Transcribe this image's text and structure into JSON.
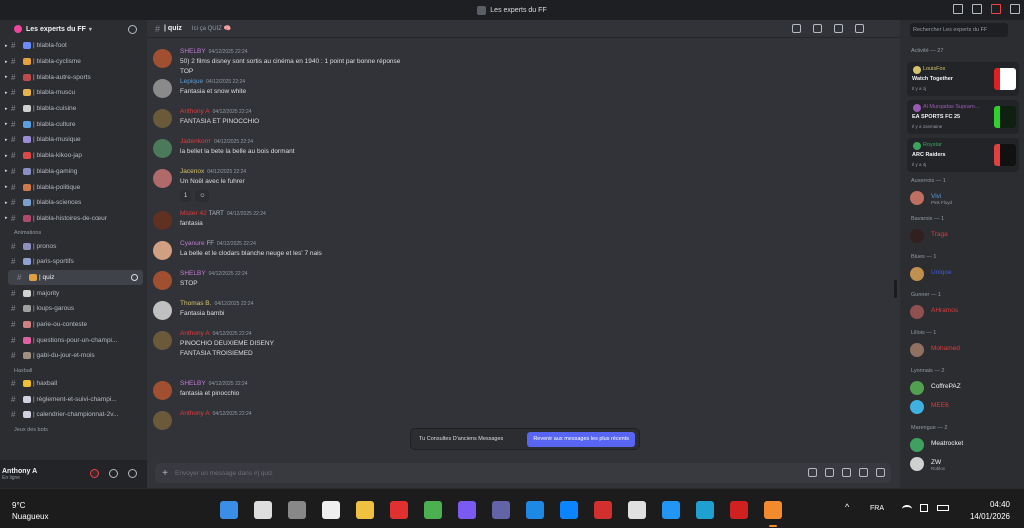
{
  "window": {
    "title": "Les experts du FF"
  },
  "server": {
    "name": "Les experts du FF"
  },
  "channels": [
    {
      "label": "| blabla-foot",
      "emoji_color": "#6b8cff"
    },
    {
      "label": "| blabla-cyclisme",
      "emoji_color": "#e6a23c"
    },
    {
      "label": "| blabla-autre-sports",
      "emoji_color": "#c04a4a"
    },
    {
      "label": "| blabla-muscu",
      "emoji_color": "#e8b34a"
    },
    {
      "label": "| blabla-cuisine",
      "emoji_color": "#cfcfcf"
    },
    {
      "label": "| blabla-culture",
      "emoji_color": "#5aa0e0"
    },
    {
      "label": "| blabla-musique",
      "emoji_color": "#9b8cd6"
    },
    {
      "label": "| blabla-kikoo-jap",
      "emoji_color": "#e04848"
    },
    {
      "label": "| blabla-gaming",
      "emoji_color": "#8a8ec6"
    },
    {
      "label": "| blabla-politique",
      "emoji_color": "#d07a4a"
    },
    {
      "label": "| blabla-sciences",
      "emoji_color": "#7aa0d0"
    },
    {
      "label": "| blabla-histoires-de-cœur",
      "emoji_color": "#b04a6a"
    }
  ],
  "animations": {
    "category": "Animations",
    "items": [
      {
        "label": "| pronos",
        "emoji_color": "#9090c0"
      },
      {
        "label": "| paris-sportifs",
        "emoji_color": "#90a0d0"
      },
      {
        "label": "| quiz",
        "emoji_color": "#e0a040",
        "selected": true
      },
      {
        "label": "| majority",
        "emoji_color": "#d0d0d0"
      },
      {
        "label": "| loups-garous",
        "emoji_color": "#a0a0a0"
      },
      {
        "label": "| parie-ou-conteste",
        "emoji_color": "#d08080"
      },
      {
        "label": "| questions-pour-un-champi...",
        "emoji_color": "#e060a0"
      },
      {
        "label": "| gabi-du-jour-et-mois",
        "emoji_color": "#a09080"
      }
    ]
  },
  "haxball": {
    "category": "Haxball",
    "items": [
      {
        "label": "| haxball",
        "emoji_color": "#f0c030"
      },
      {
        "label": "| règlement-et-suivi-champi...",
        "emoji_color": "#d0d0e0"
      },
      {
        "label": "| calendrier-championnat-2v...",
        "emoji_color": "#d0d0e0"
      }
    ]
  },
  "jeux_category": "Jeux des bots",
  "user": {
    "name": "Anthony A",
    "status": "En ligne"
  },
  "header": {
    "channel": "| quiz",
    "topic": "Ici ça QUIZ 🧠"
  },
  "messages": [
    {
      "author": "SHELBY",
      "color": "#c27bd4",
      "date": "04/12/2025 22:24",
      "lines": [
        "50) 2 films disney sont sortis au cinéma en 1940 : 1 point par bonne réponse",
        "TOP"
      ],
      "av": "#a05030"
    },
    {
      "author": "Lepique",
      "color": "#5b9bd5",
      "date": "04/12/2025 22:24",
      "lines": [
        "Fantasia et snow white"
      ],
      "av": "#8a8a8a"
    },
    {
      "author": "Anthony A",
      "color": "#e03c3c",
      "date": "04/12/2025 22:24",
      "lines": [
        "FANTASIA ET PINOCCHIO"
      ],
      "av": "#6a5a3a"
    },
    {
      "author": "Jadenkorrr",
      "color": "#e03c3c",
      "date": "04/12/2025 22:24",
      "lines": [
        "la bellet la bete la belle au bois dormant"
      ],
      "av": "#4a7a5a"
    },
    {
      "author": "Jacenox",
      "color": "#d6c36b",
      "date": "04/12/2025 22:24",
      "lines": [
        "Un Noël avec le fuhrer"
      ],
      "av": "#b06a6a",
      "reaction": "1"
    },
    {
      "author": "Mister 42",
      "color": "#e03c3c",
      "date": "04/12/2025 22:24",
      "lines": [
        "fantasia"
      ],
      "av": "#603020",
      "tag": "TART"
    },
    {
      "author": "Cyanure",
      "color": "#c27bd4",
      "date": "04/12/2025 22:24",
      "lines": [
        "La belle et le clodars blanche neuge et les' 7 nais"
      ],
      "av": "#d0a080",
      "tag": "FF"
    },
    {
      "author": "SHELBY",
      "color": "#c27bd4",
      "date": "04/12/2025 22:24",
      "lines": [
        "STOP"
      ],
      "av": "#a05030"
    },
    {
      "author": "Thomas B.",
      "color": "#d6c36b",
      "date": "04/12/2025 22:24",
      "lines": [
        "Fantasia bambi"
      ],
      "av": "#c0c0c0"
    },
    {
      "author": "Anthony A",
      "color": "#e03c3c",
      "date": "04/12/2025 22:24",
      "lines": [
        "PINOCHIO DEUXIEME DISENY",
        "FANTASIA TROISIEMED"
      ],
      "av": "#6a5a3a"
    },
    {
      "author": "SHELBY",
      "color": "#c27bd4",
      "date": "04/12/2025 22:24",
      "lines": [
        "fantasia et pinocchio"
      ],
      "av": "#a05030"
    },
    {
      "author": "Anthony A",
      "color": "#e03c3c",
      "date": "04/12/2025 22:24",
      "lines": [
        ""
      ],
      "av": "#6a5a3a"
    }
  ],
  "banner": {
    "text": "Tu Consultes D'anciens Messages",
    "button": "Revenir aux messages les plus récents"
  },
  "composer": {
    "placeholder": "Envoyer un message dans #",
    "channel": "| quiz"
  },
  "search": {
    "placeholder": "Rechercher Les experts du FF"
  },
  "activity": {
    "header": "Activité — 27",
    "cards": [
      {
        "user": "LouisFox",
        "user_color": "#d6c36b",
        "game": "Watch Together",
        "ago": "Il y a 1j",
        "thumb": "#ffffff",
        "accent": "#e02020"
      },
      {
        "user": "Al Murqadas Supram...",
        "user_color": "#9b59b6",
        "game": "EA SPORTS FC 25",
        "ago": "Il y a 1semaine",
        "thumb": "#102010",
        "accent": "#30d030"
      },
      {
        "user": "Roystar",
        "user_color": "#3ba55d",
        "game": "ARC Raiders",
        "ago": "Il y a 4j",
        "thumb": "#111111",
        "accent": "#e04040"
      }
    ]
  },
  "roles": [
    {
      "role": "Auxerrois — 1",
      "members": [
        {
          "name": "Vivi",
          "color": "#5b9bd5",
          "sub": "Pink Floyd",
          "av": "#c07060"
        }
      ]
    },
    {
      "role": "Bavarois — 1",
      "members": [
        {
          "name": "Traga",
          "color": "#e03c3c",
          "sub": "",
          "av": "#302020"
        }
      ]
    },
    {
      "role": "Blues — 1",
      "members": [
        {
          "name": "Uniqoe",
          "color": "#3b5bd5",
          "sub": "",
          "av": "#c09050"
        }
      ]
    },
    {
      "role": "Gunner — 1",
      "members": [
        {
          "name": "AHramos",
          "color": "#e03c3c",
          "sub": "",
          "av": "#905050"
        }
      ]
    },
    {
      "role": "Lillois — 1",
      "members": [
        {
          "name": "Mohamed",
          "color": "#e03c3c",
          "sub": "",
          "av": "#907060"
        }
      ]
    },
    {
      "role": "Lyonnais — 2",
      "members": [
        {
          "name": "CoffrePAZ",
          "color": "#f2f3f5",
          "sub": "",
          "av": "#50a050",
          "tag": "GOAT"
        },
        {
          "name": "MEE6",
          "color": "#e03c3c",
          "sub": "",
          "av": "#40b0e0",
          "tag": "APP"
        }
      ]
    },
    {
      "role": "Marengue — 2",
      "members": [
        {
          "name": "Meatrocket",
          "color": "#f2f3f5",
          "sub": "",
          "av": "#40a060"
        },
        {
          "name": "ZW",
          "color": "#f2f3f5",
          "sub": "Roblox",
          "av": "#d0d0d0"
        }
      ]
    }
  ],
  "taskbar": {
    "temp": "9°C",
    "weather": "Nuagueux",
    "lang": "FRA",
    "time": "04:40",
    "date": "14/01/2026"
  }
}
